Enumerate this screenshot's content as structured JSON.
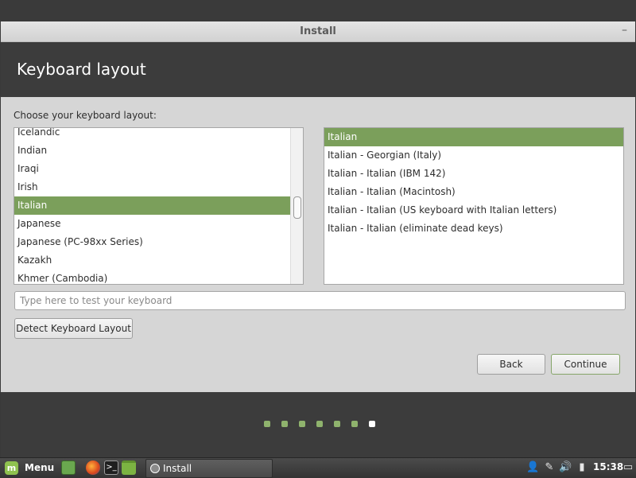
{
  "window": {
    "title": "Install",
    "minimize_glyph": "–"
  },
  "header": {
    "title": "Keyboard layout"
  },
  "prompt": "Choose your keyboard layout:",
  "layouts": {
    "items": [
      "Icelandic",
      "Indian",
      "Iraqi",
      "Irish",
      "Italian",
      "Japanese",
      "Japanese (PC-98xx Series)",
      "Kazakh",
      "Khmer (Cambodia)"
    ],
    "selected": "Italian"
  },
  "variants": {
    "items": [
      "Italian",
      "Italian - Georgian (Italy)",
      "Italian - Italian (IBM 142)",
      "Italian - Italian (Macintosh)",
      "Italian - Italian (US keyboard with Italian letters)",
      "Italian - Italian (eliminate dead keys)"
    ],
    "selected": "Italian"
  },
  "test_input": {
    "placeholder": "Type here to test your keyboard",
    "value": ""
  },
  "buttons": {
    "detect": "Detect Keyboard Layout",
    "back": "Back",
    "continue": "Continue"
  },
  "progress": {
    "total_steps": 7,
    "current_step": 7,
    "active_color": "#8fb36d",
    "current_color": "#ffffff"
  },
  "taskbar": {
    "menu_label": "Menu",
    "launchers": [
      "desktop-icon",
      "firefox-icon",
      "terminal-icon",
      "files-icon"
    ],
    "task_label": "Install",
    "tray": [
      "user-icon",
      "network-icon",
      "volume-icon",
      "battery-icon",
      "display-icon"
    ],
    "clock": "15:38"
  },
  "colors": {
    "selection": "#7b9f5b",
    "header_bg": "#3c3c3c",
    "window_bg": "#d6d6d6"
  }
}
